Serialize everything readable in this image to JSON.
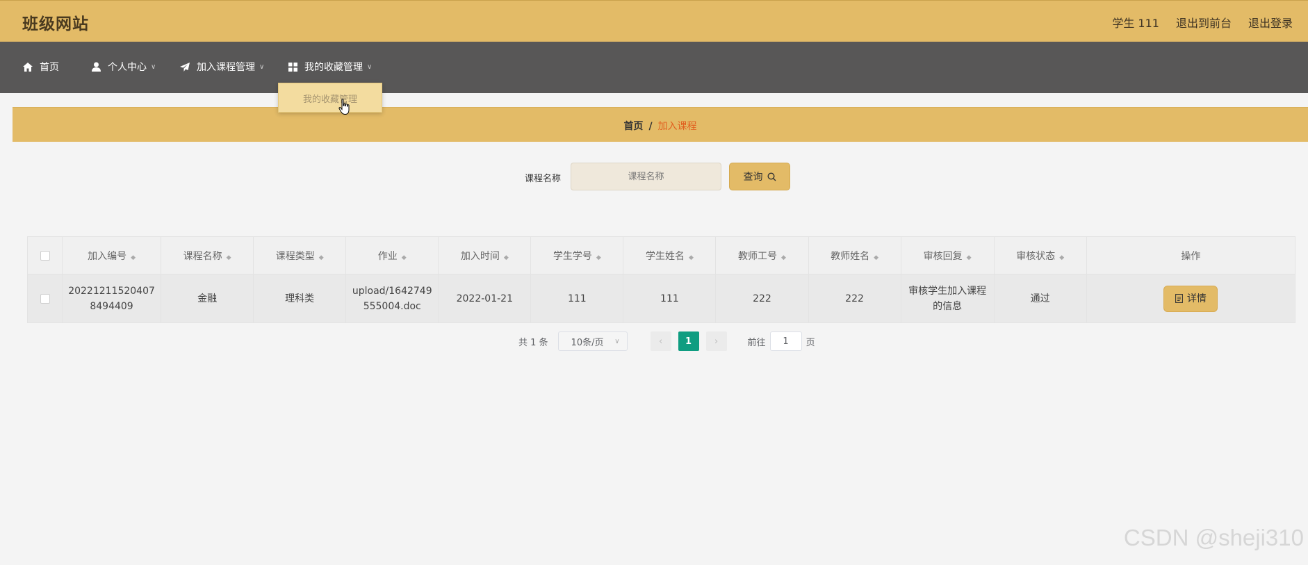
{
  "header": {
    "site_title": "班级网站",
    "user_label": "学生 111",
    "back_frontend": "退出到前台",
    "logout": "退出登录"
  },
  "nav": {
    "items": [
      {
        "label": "首页",
        "icon": "home-icon"
      },
      {
        "label": "个人中心",
        "icon": "user-icon"
      },
      {
        "label": "加入课程管理",
        "icon": "paper-plane-icon"
      },
      {
        "label": "我的收藏管理",
        "icon": "grid-icon"
      }
    ],
    "dropdown_item": "我的收藏管理"
  },
  "breadcrumb": {
    "home": "首页",
    "separator": "/",
    "current": "加入课程"
  },
  "search": {
    "label": "课程名称",
    "placeholder": "课程名称",
    "button": "查询"
  },
  "table": {
    "headers": [
      "加入编号",
      "课程名称",
      "课程类型",
      "作业",
      "加入时间",
      "学生学号",
      "学生姓名",
      "教师工号",
      "教师姓名",
      "审核回复",
      "审核状态",
      "操作"
    ],
    "rows": [
      {
        "id": "20221211520407 8494409",
        "course_name": "金融",
        "course_type": "理科类",
        "homework": "upload/1642749 555004.doc",
        "join_time": "2022-01-21",
        "student_no": "111",
        "student_name": "111",
        "teacher_no": "222",
        "teacher_name": "222",
        "review_reply": "审核学生加入课程的信息",
        "review_status": "通过",
        "action": "详情"
      }
    ]
  },
  "pagination": {
    "total": "共 1 条",
    "page_size": "10条/页",
    "current_page": "1",
    "goto_label": "前往",
    "goto_value": "1",
    "page_unit": "页"
  },
  "watermark": "CSDN @sheji310",
  "colors": {
    "accent": "#e3bb67",
    "nav_bg": "#585757",
    "active_page": "#0f9d81",
    "breadcrumb_current": "#e15f1f"
  }
}
